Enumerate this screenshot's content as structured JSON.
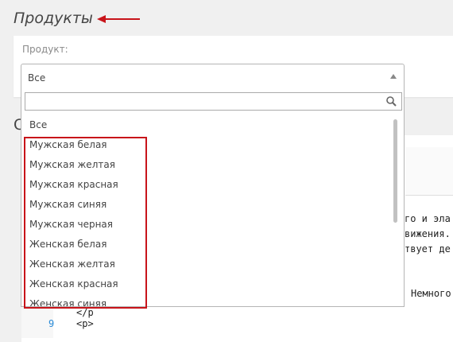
{
  "page": {
    "title": "Продукты",
    "second_heading_initial": "С"
  },
  "filter": {
    "label": "Продукт:",
    "selected_value": "Все",
    "search_value": "",
    "options": [
      "Все",
      "Мужская белая",
      "Мужская желтая",
      "Мужская красная",
      "Мужская синяя",
      "Мужская черная",
      "Женская белая",
      "Женская желтая",
      "Женская красная",
      "Женская синяя"
    ]
  },
  "code_fragments": {
    "line1": "го и эла",
    "line2": "вижения.",
    "line3": "твует де",
    "line4": "Немного",
    "line_partial_tag": "</p",
    "line_number_9": "9",
    "line_9_code": "<p>"
  },
  "colors": {
    "annotation_red": "#c8141a",
    "line_number_blue": "#2a8bd8"
  },
  "icons": {
    "search": "search-icon",
    "caret": "caret-up-icon",
    "annotation_arrow": "arrow-left-icon"
  }
}
